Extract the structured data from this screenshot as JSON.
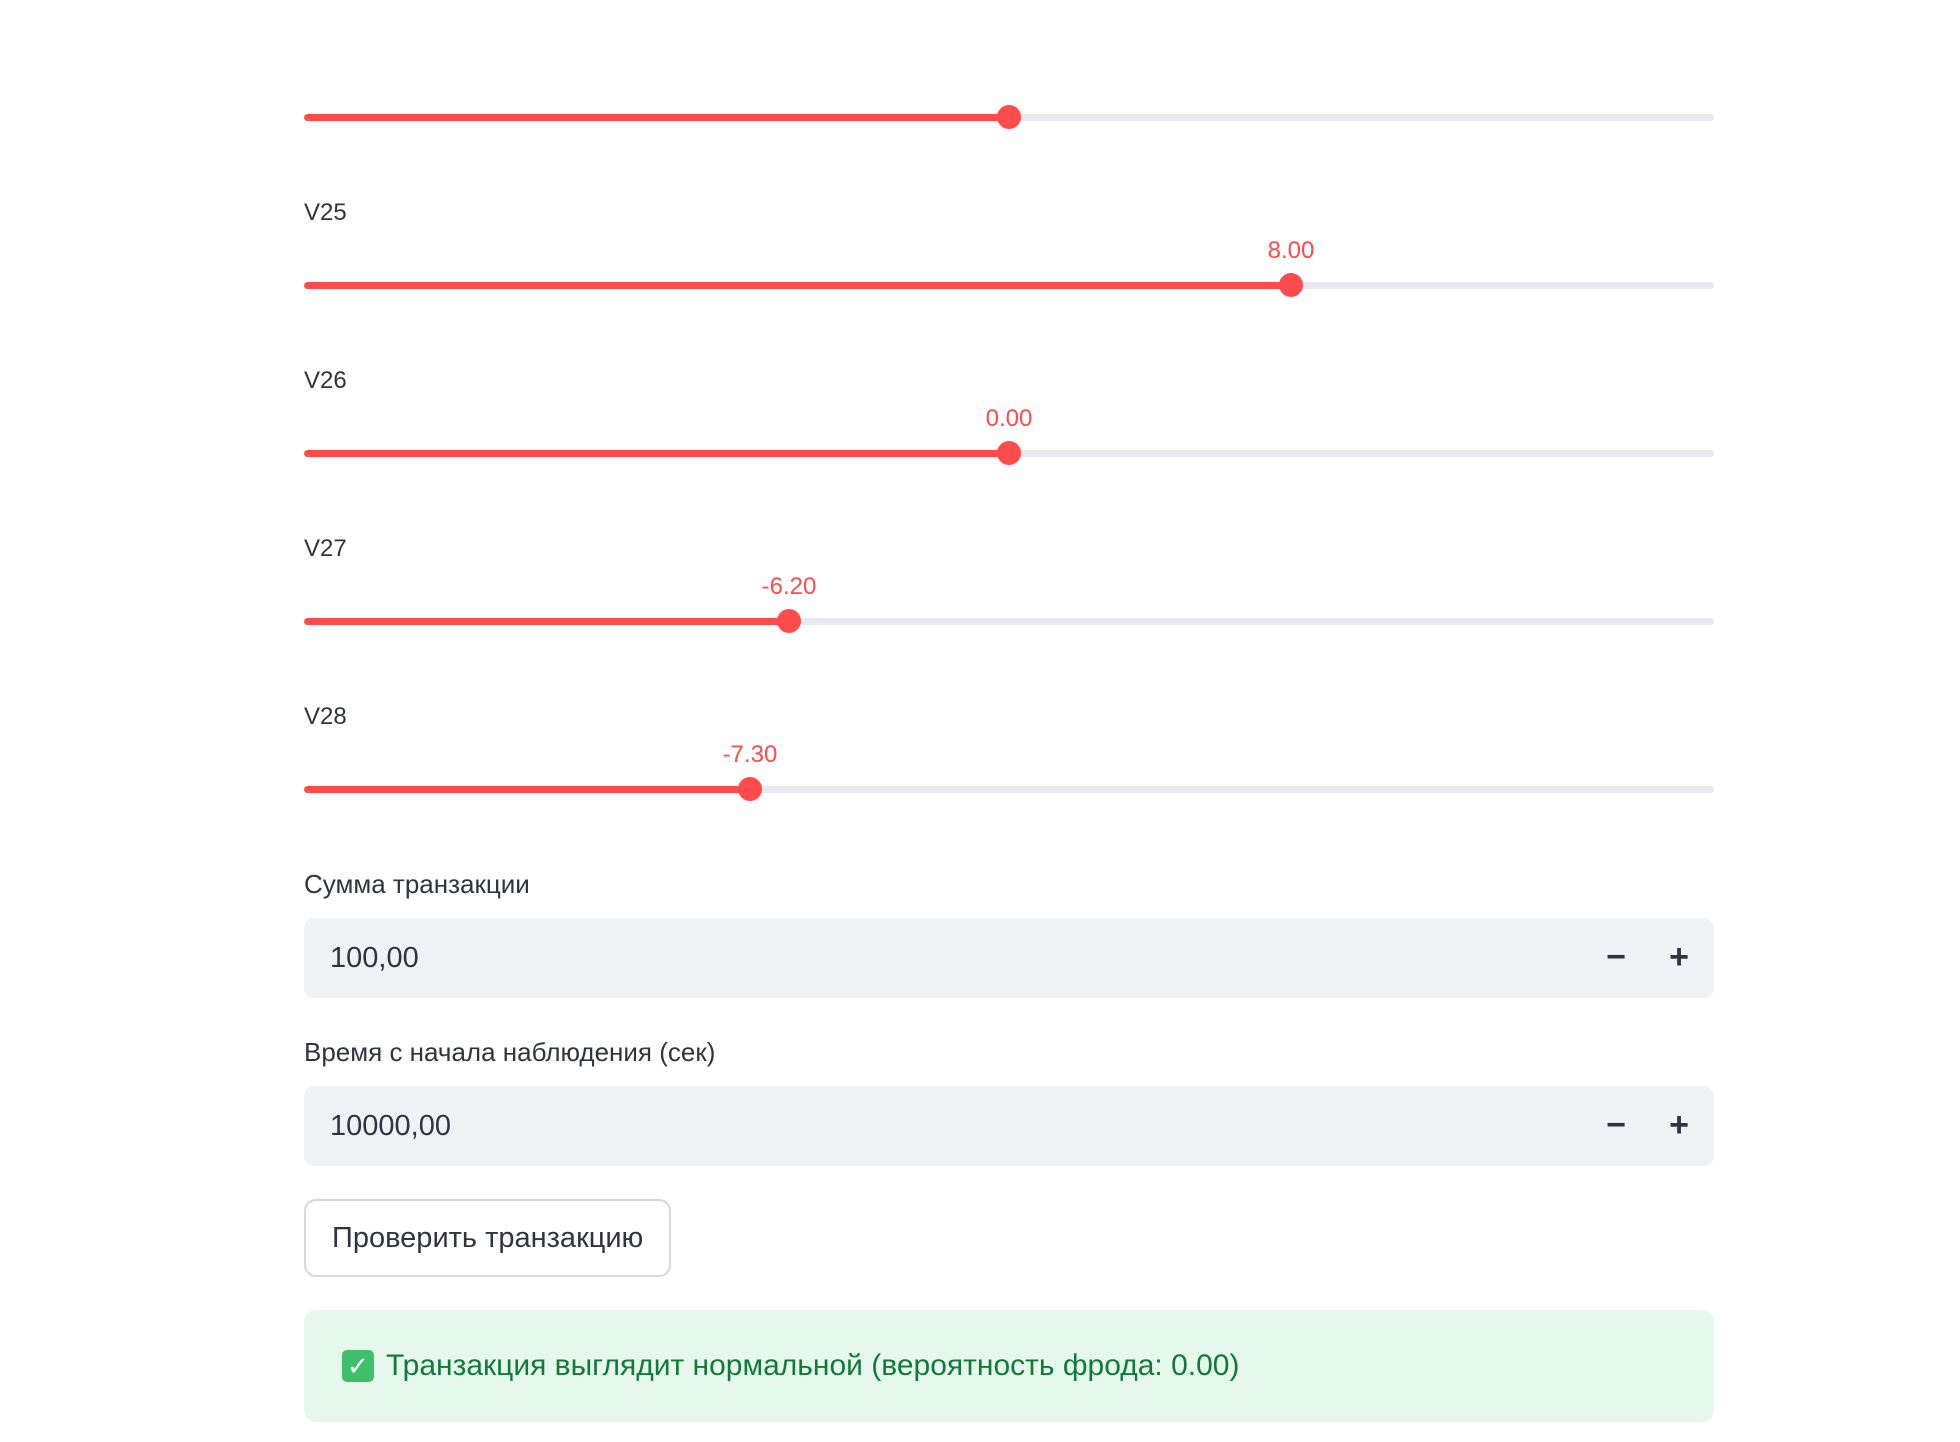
{
  "sliders": [
    {
      "id": "v24",
      "label": "",
      "value_label": "",
      "fraction": 0.5
    },
    {
      "id": "v25",
      "label": "V25",
      "value_label": "8.00",
      "fraction": 0.7
    },
    {
      "id": "v26",
      "label": "V26",
      "value_label": "0.00",
      "fraction": 0.5
    },
    {
      "id": "v27",
      "label": "V27",
      "value_label": "-6.20",
      "fraction": 0.344
    },
    {
      "id": "v28",
      "label": "V28",
      "value_label": "-7.30",
      "fraction": 0.316
    }
  ],
  "amount": {
    "label": "Сумма транзакции",
    "value": "100,00",
    "minus": "−",
    "plus": "+"
  },
  "time": {
    "label": "Время с начала наблюдения (сек)",
    "value": "10000,00",
    "minus": "−",
    "plus": "+"
  },
  "check_button_label": "Проверить транзакцию",
  "result": {
    "icon": "check-mark-icon",
    "icon_glyph": "✓",
    "text": "Транзакция выглядит нормальной (вероятность фрода: 0.00)"
  },
  "colors": {
    "accent": "#ff4b4b",
    "track": "#e6e9ef",
    "success_bg": "#e6f8ec",
    "success_text": "#117a3b"
  }
}
